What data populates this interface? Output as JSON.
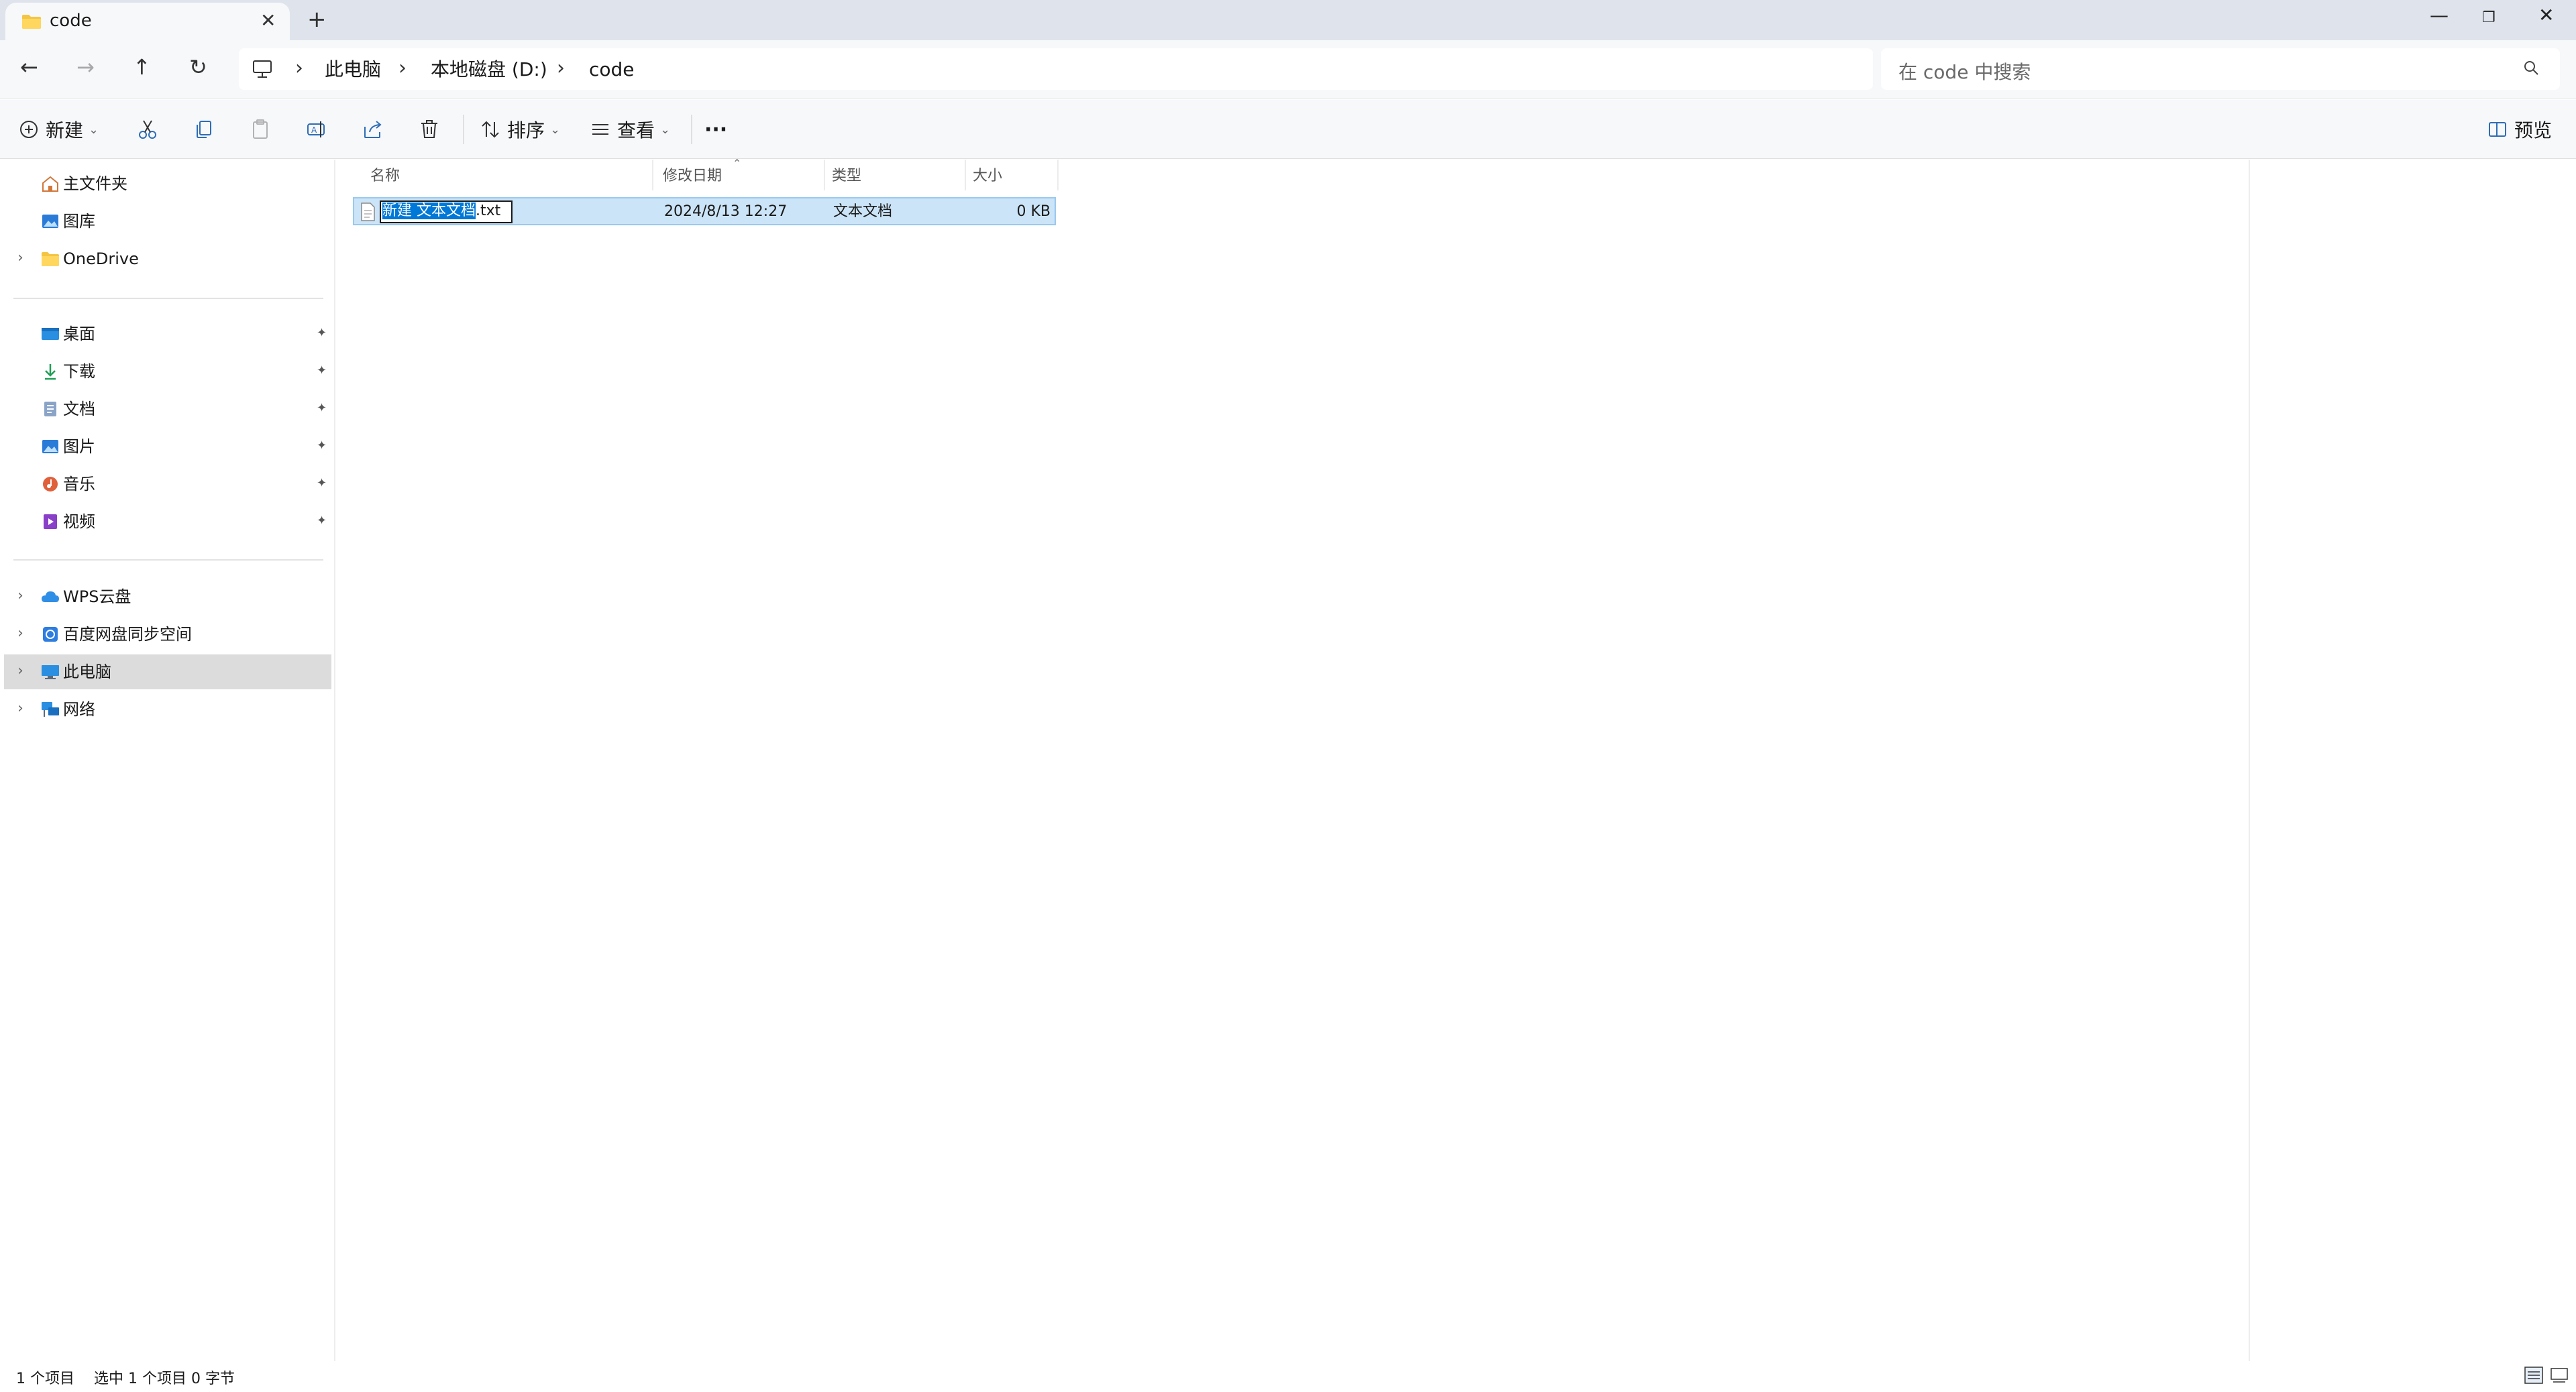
{
  "window": {
    "tab_title": "code",
    "tab_close": "✕",
    "new_tab": "+",
    "minimize": "—",
    "maximize": "❐",
    "close": "✕"
  },
  "nav": {
    "back": "←",
    "forward": "→",
    "up": "↑",
    "refresh": "↻"
  },
  "breadcrumb": {
    "separator": "›",
    "items": [
      "此电脑",
      "本地磁盘 (D:)",
      "code"
    ]
  },
  "search": {
    "placeholder": "在 code 中搜索"
  },
  "toolbar": {
    "new_label": "新建",
    "sort_label": "排序",
    "view_label": "查看",
    "more_label": "···",
    "preview_label": "预览",
    "caret": "⌄"
  },
  "sidebar": {
    "chevron": "›",
    "pin": "📌",
    "top_items": [
      {
        "label": "主文件夹",
        "icon": "home-icon"
      },
      {
        "label": "图库",
        "icon": "gallery-icon"
      },
      {
        "label": "OneDrive",
        "icon": "folder-icon",
        "expandable": true
      }
    ],
    "quick_access": [
      {
        "label": "桌面",
        "icon": "desktop-icon",
        "pinned": true
      },
      {
        "label": "下载",
        "icon": "download-icon",
        "pinned": true
      },
      {
        "label": "文档",
        "icon": "documents-icon",
        "pinned": true
      },
      {
        "label": "图片",
        "icon": "pictures-icon",
        "pinned": true
      },
      {
        "label": "音乐",
        "icon": "music-icon",
        "pinned": true
      },
      {
        "label": "视频",
        "icon": "videos-icon",
        "pinned": true
      }
    ],
    "locations": [
      {
        "label": "WPS云盘",
        "icon": "cloud-icon",
        "expandable": true
      },
      {
        "label": "百度网盘同步空间",
        "icon": "baidu-sync-icon",
        "expandable": true
      },
      {
        "label": "此电脑",
        "icon": "this-pc-icon",
        "expandable": true,
        "selected": true
      },
      {
        "label": "网络",
        "icon": "network-icon",
        "expandable": true
      }
    ]
  },
  "filelist": {
    "columns": [
      "名称",
      "修改日期",
      "类型",
      "大小"
    ],
    "sort_indicator": "⌃",
    "rows": [
      {
        "name_selected": "新建 文本文档",
        "name_ext": ".txt",
        "modified": "2024/8/13 12:27",
        "type": "文本文档",
        "size": "0 KB"
      }
    ]
  },
  "status": {
    "count": "1 个项目",
    "selected": "选中 1 个项目  0 字节"
  },
  "colors": {
    "accent": "#0078d7",
    "selection_bg": "#cce4f7",
    "selection_border": "#99c9ef",
    "titlebar_bg": "#dfe3eb"
  }
}
